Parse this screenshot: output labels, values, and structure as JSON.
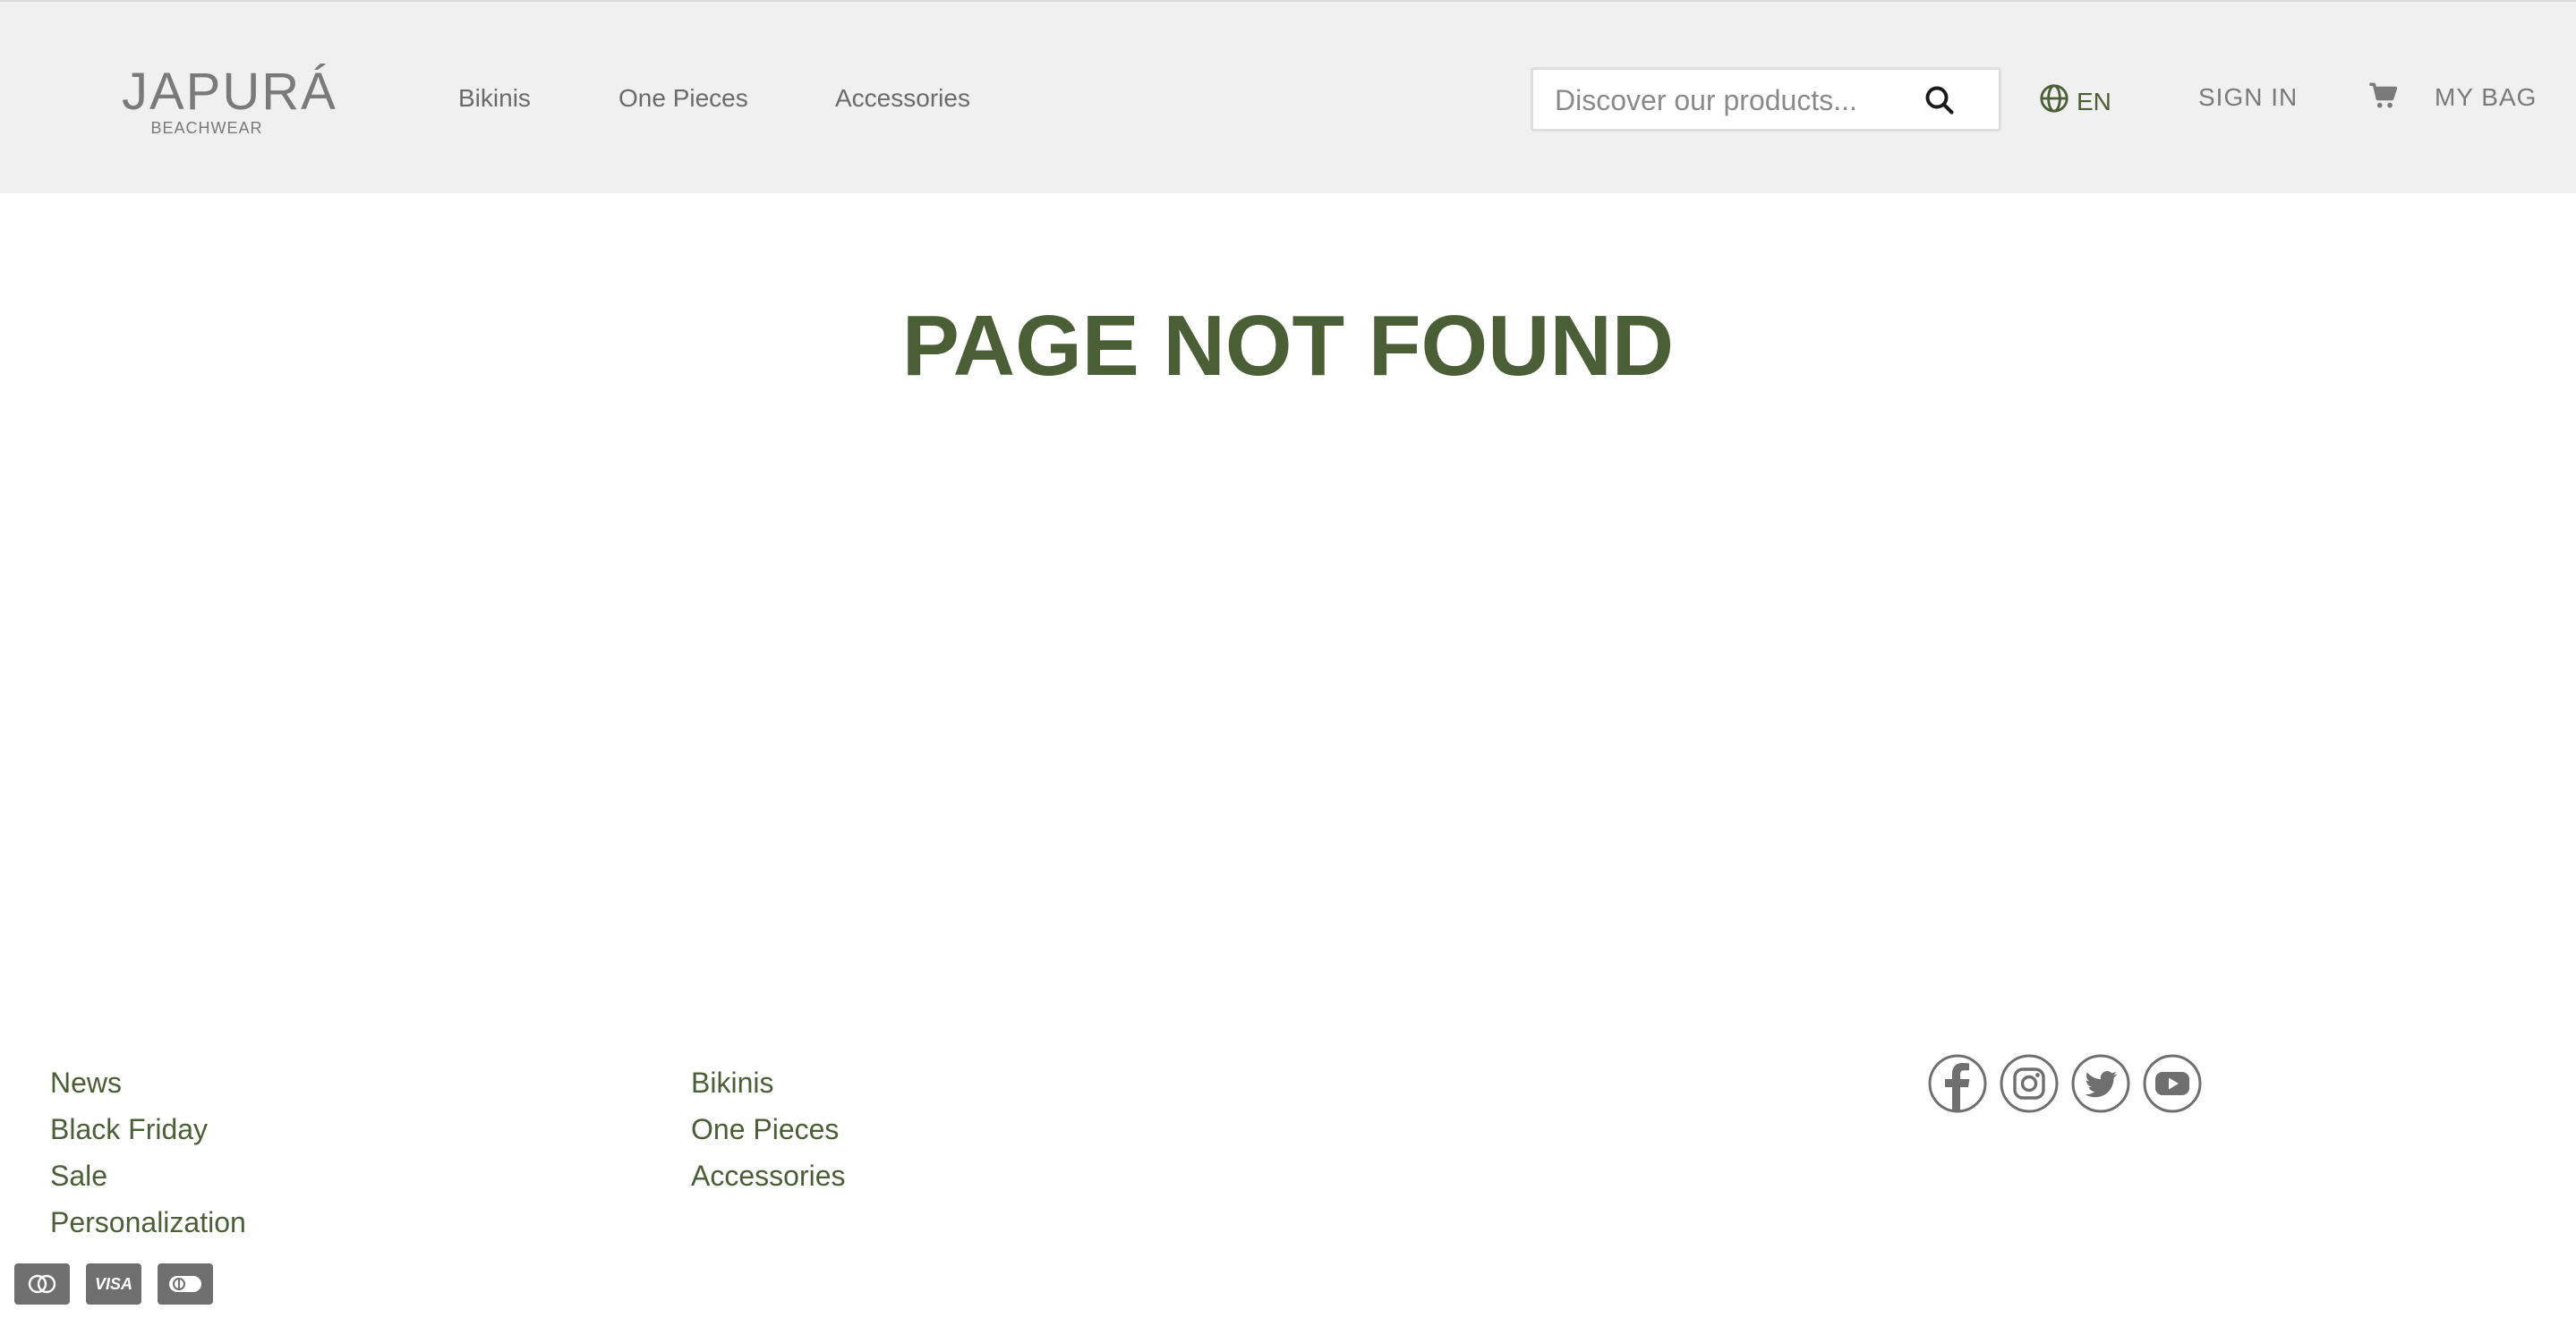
{
  "header": {
    "logo": {
      "name": "JAPURÁ",
      "tagline": "BEACHWEAR"
    },
    "nav": [
      {
        "label": "Bikinis"
      },
      {
        "label": "One Pieces"
      },
      {
        "label": "Accessories"
      }
    ],
    "search": {
      "placeholder": "Discover our products...",
      "value": ""
    },
    "language": {
      "label": "EN",
      "icon": "globe-icon"
    },
    "sign_in": "SIGN IN",
    "bag": {
      "label": "MY BAG",
      "icon": "cart-icon"
    }
  },
  "main": {
    "title": "PAGE NOT FOUND"
  },
  "footer": {
    "column1": [
      "News",
      "Black Friday",
      "Sale",
      "Personalization"
    ],
    "column2": [
      "Bikinis",
      "One Pieces",
      "Accessories"
    ],
    "social": [
      "facebook-icon",
      "instagram-icon",
      "twitter-icon",
      "youtube-icon"
    ],
    "payments": {
      "visa_label": "VISA",
      "icons": [
        "mastercard-icon",
        "visa-icon",
        "diners-icon"
      ]
    }
  },
  "colors": {
    "accent": "#4a5f35",
    "header_bg": "#f0f0f0",
    "muted_text": "#7a7a7a",
    "icon_gray": "#6f6f6f"
  }
}
